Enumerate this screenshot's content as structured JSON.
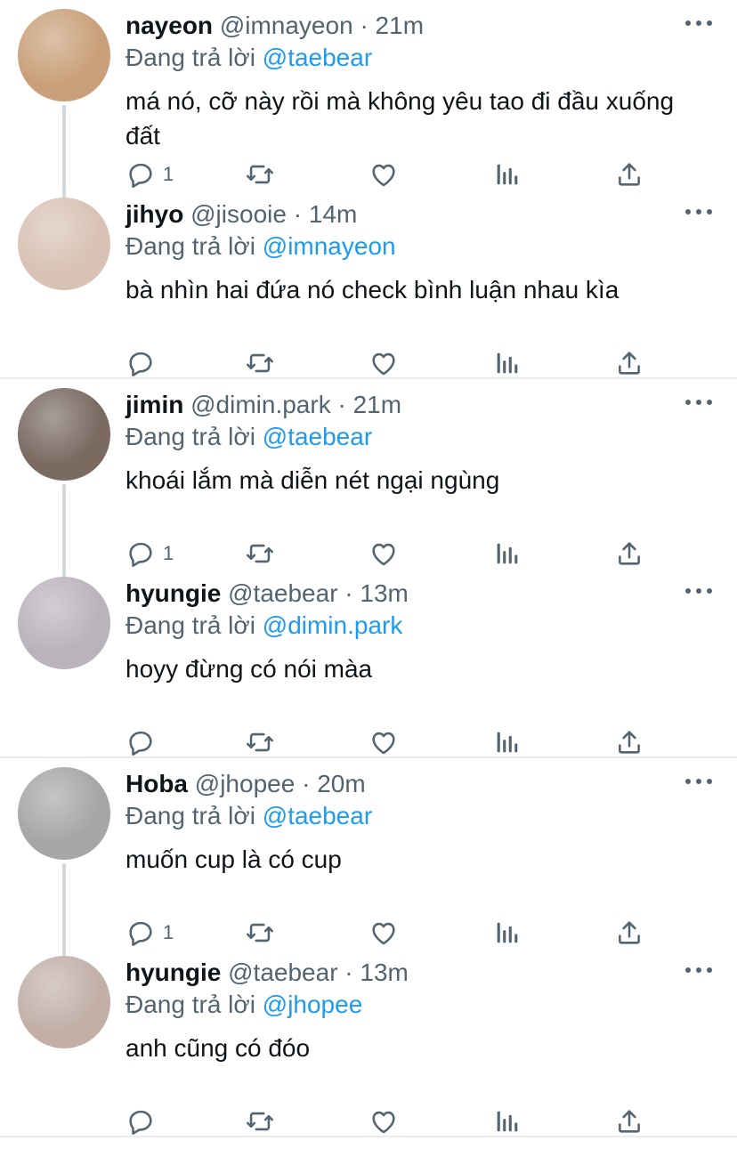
{
  "reply_prefix": "Đang trả lời",
  "dot": "·",
  "threads": [
    {
      "tweets": [
        {
          "name": "nayeon",
          "handle": "@imnayeon",
          "time": "21m",
          "reply_to": "@taebear",
          "text": "má nó, cỡ này rồi mà không yêu tao đi đầu xuống đất",
          "reply_count": "1",
          "avatar_color": "#c9a07a"
        },
        {
          "name": "jihyo",
          "handle": "@jisooie",
          "time": "14m",
          "reply_to": "@imnayeon",
          "text": "bà nhìn hai đứa nó check bình luận nhau kìa",
          "reply_count": "",
          "avatar_color": "#d8c2b4"
        }
      ]
    },
    {
      "tweets": [
        {
          "name": "jimin",
          "handle": "@dimin.park",
          "time": "21m",
          "reply_to": "@taebear",
          "text": "khoái lắm mà diễn nét ngại ngùng",
          "reply_count": "1",
          "avatar_color": "#7a6a62"
        },
        {
          "name": "hyungie",
          "handle": "@taebear",
          "time": "13m",
          "reply_to": "@dimin.park",
          "text": "hoyy đừng có nói màa",
          "reply_count": "",
          "avatar_color": "#b9b4bb"
        }
      ]
    },
    {
      "tweets": [
        {
          "name": "Hoba",
          "handle": "@jhopee",
          "time": "20m",
          "reply_to": "@taebear",
          "text": "muốn cup là có cup",
          "reply_count": "1",
          "avatar_color": "#a8a6a4"
        },
        {
          "name": "hyungie",
          "handle": "@taebear",
          "time": "13m",
          "reply_to": "@jhopee",
          "text": "anh cũng có đóo",
          "reply_count": "",
          "avatar_color": "#c2b0a8"
        }
      ]
    }
  ],
  "colors": {
    "link": "#1d9bf0",
    "secondary": "#536471",
    "primary": "#0f1419",
    "divider": "#e6ecf0"
  },
  "icons": [
    "reply-icon",
    "retweet-icon",
    "like-icon",
    "analytics-icon",
    "share-icon",
    "more-icon"
  ]
}
